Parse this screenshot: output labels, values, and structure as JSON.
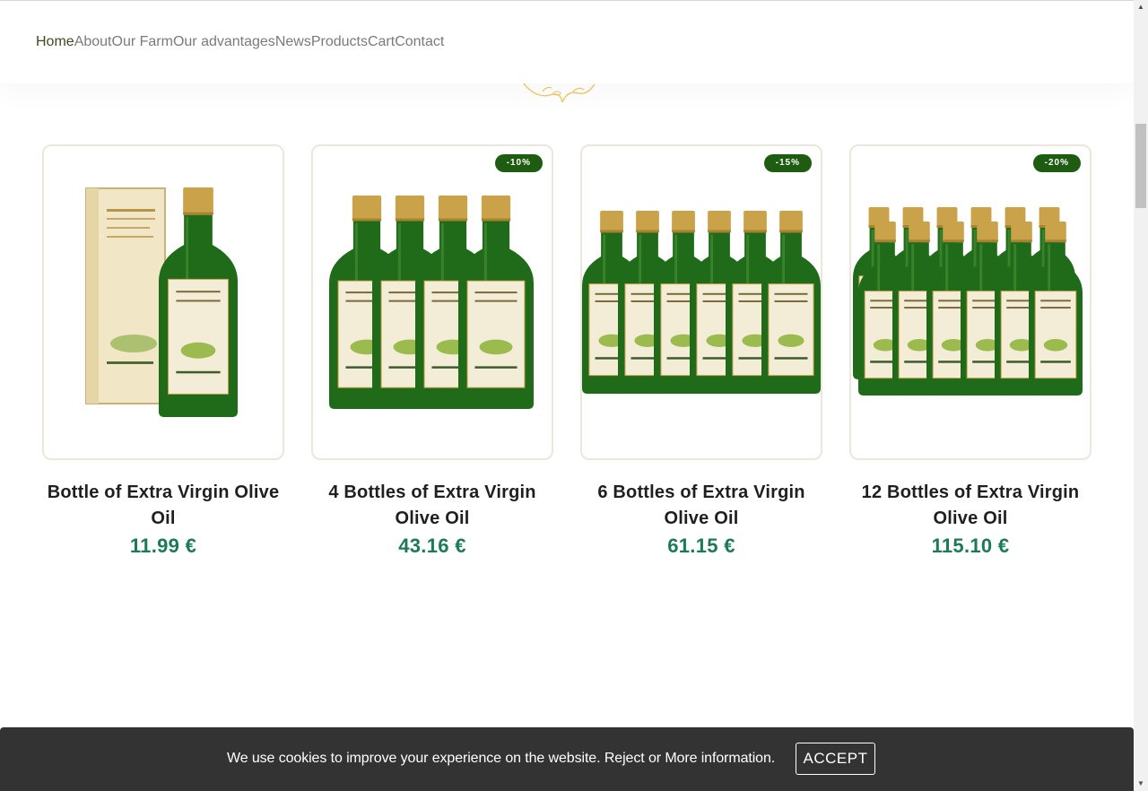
{
  "nav": {
    "items": [
      {
        "label": "Home",
        "active": true
      },
      {
        "label": "About",
        "active": false
      },
      {
        "label": "Our Farm",
        "active": false
      },
      {
        "label": "Our advantages",
        "active": false
      },
      {
        "label": "News",
        "active": false
      },
      {
        "label": "Products",
        "active": false
      },
      {
        "label": "Cart",
        "active": false
      },
      {
        "label": "Contact",
        "active": false
      }
    ]
  },
  "products": [
    {
      "title": "Bottle of Extra Virgin Olive Oil",
      "price": "11.99 €",
      "badge": "",
      "bottles": 1,
      "image": "olive-oil-bottle-with-gift-box"
    },
    {
      "title": "4 Bottles of Extra Virgin Olive Oil",
      "price": "43.16 €",
      "badge": "-10%",
      "bottles": 4,
      "image": "four-olive-oil-bottles"
    },
    {
      "title": "6 Bottles of Extra Virgin Olive Oil",
      "price": "61.15 €",
      "badge": "-15%",
      "bottles": 6,
      "image": "six-olive-oil-bottles"
    },
    {
      "title": "12 Bottles of Extra Virgin Olive Oil",
      "price": "115.10 €",
      "badge": "-20%",
      "bottles": 12,
      "image": "twelve-olive-oil-bottles"
    }
  ],
  "cookie": {
    "text_before": "We use cookies to improve your experience on the website.",
    "reject_label": "Reject",
    "or_label": "or",
    "more_label": "More information.",
    "accept_label": "ACCEPT"
  },
  "colors": {
    "nav_active": "#3c4a20",
    "badge_bg": "#1e5c12",
    "price": "#1c7a56",
    "cookie_bg": "#333333",
    "bottle_glass": "#1f6b1a",
    "bottle_cap": "#c9a24a"
  }
}
